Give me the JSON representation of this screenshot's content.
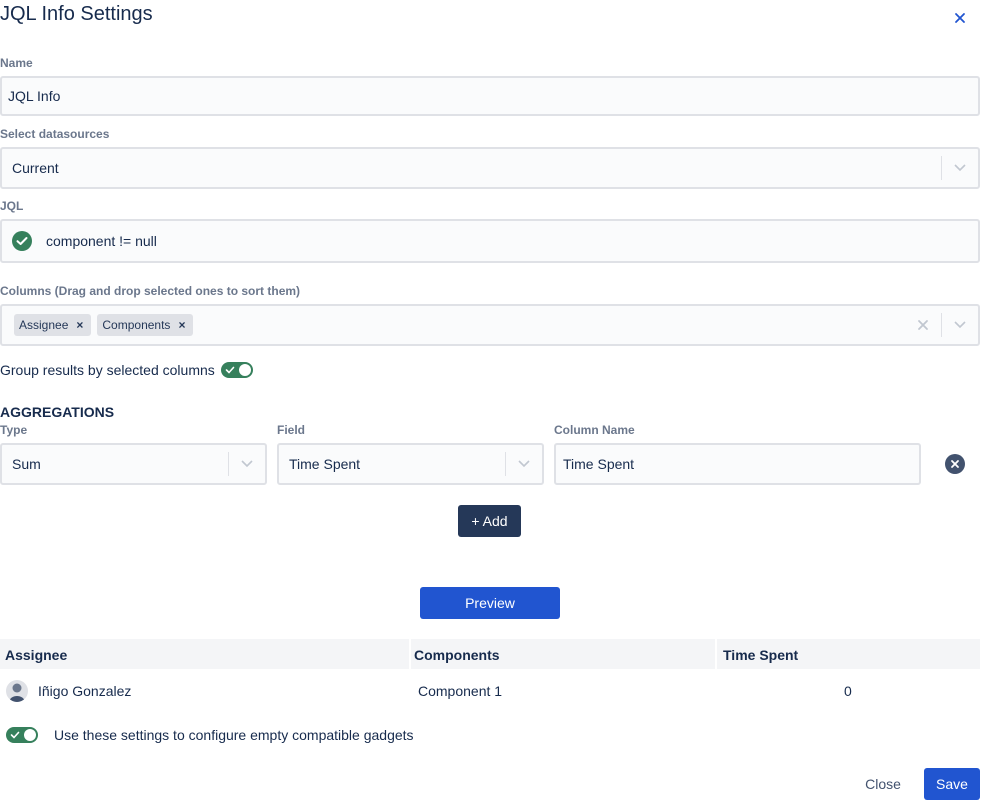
{
  "dialog": {
    "title": "JQL Info Settings"
  },
  "name": {
    "label": "Name",
    "value": "JQL Info"
  },
  "datasource": {
    "label": "Select datasources",
    "value": "Current"
  },
  "jql": {
    "label": "JQL",
    "value": "component != null",
    "status": "valid"
  },
  "columns": {
    "label": "Columns (Drag and drop selected ones to sort them)",
    "tags": [
      "Assignee",
      "Components"
    ]
  },
  "group": {
    "label": "Group results by selected columns",
    "enabled": true
  },
  "aggregations": {
    "heading": "AGGREGATIONS",
    "type_label": "Type",
    "field_label": "Field",
    "column_name_label": "Column Name",
    "row": {
      "type": "Sum",
      "field": "Time Spent",
      "column_name": "Time Spent"
    },
    "add_label": "+ Add"
  },
  "preview": {
    "label": "Preview"
  },
  "table": {
    "headers": [
      "Assignee",
      "Components",
      "Time Spent"
    ],
    "rows": [
      {
        "assignee": "Iñigo Gonzalez",
        "components": "Component 1",
        "time_spent": "0"
      }
    ]
  },
  "use_settings": {
    "label": "Use these settings to configure empty compatible gadgets",
    "enabled": true
  },
  "footer": {
    "close_label": "Close",
    "save_label": "Save"
  },
  "colors": {
    "accent": "#2155d0",
    "dark": "#253858",
    "success": "#36805c"
  }
}
